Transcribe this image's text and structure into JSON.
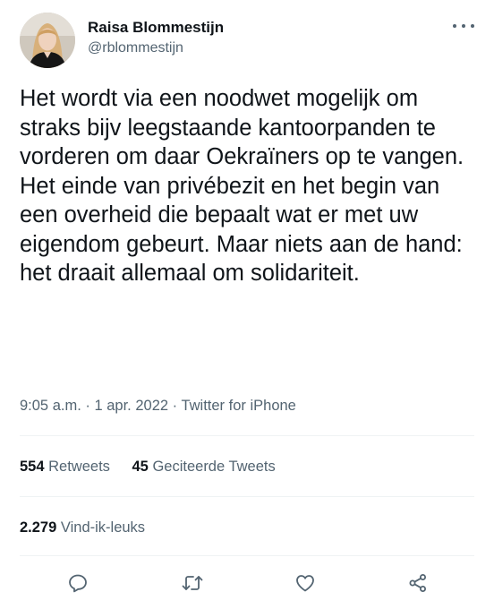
{
  "user": {
    "display_name": "Raisa Blommestijn",
    "handle": "@rblommestijn"
  },
  "tweet": {
    "text": "Het wordt via een noodwet mogelijk om straks bijv leegstaande kantoorpanden te vorderen om daar Oekraïners op te vangen. Het einde van privébezit en het begin van een overheid die bepaalt wat er met uw eigendom gebeurt. Maar niets aan de hand: het draait allemaal om solidariteit.",
    "time": "9:05 a.m.",
    "separator": "·",
    "date": "1 apr. 2022",
    "source": "Twitter for iPhone"
  },
  "stats": {
    "retweets_count": "554",
    "retweets_label": "Retweets",
    "quotes_count": "45",
    "quotes_label": "Geciteerde Tweets",
    "likes_count": "2.279",
    "likes_label": "Vind-ik-leuks"
  },
  "actions": [
    {
      "icon": "reply-icon"
    },
    {
      "icon": "retweet-icon"
    },
    {
      "icon": "like-icon"
    },
    {
      "icon": "share-icon"
    }
  ],
  "colors": {
    "text_primary": "#0f1419",
    "text_secondary": "#536471",
    "divider": "#eff3f4"
  }
}
